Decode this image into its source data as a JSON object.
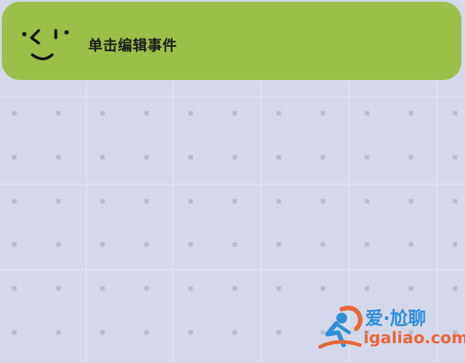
{
  "event_card": {
    "label": "单击编辑事件",
    "icon": "smiley-face-icon",
    "color": "#9bbf49"
  },
  "background": {
    "color": "#d4d8ea",
    "dot_color": "#b9bccb",
    "line_color": "#dde0ee"
  },
  "watermark": {
    "title": "爱·尬聊",
    "url": "igaliao.com",
    "logo": "runner-logo-icon",
    "title_color": "#2f8fd6",
    "url_color": "#e8673a"
  }
}
